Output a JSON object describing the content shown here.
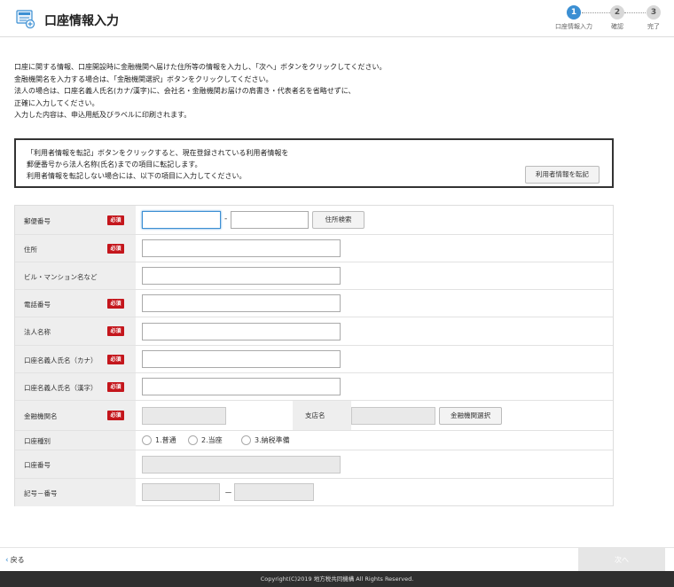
{
  "header": {
    "title": "口座情報入力",
    "steps": [
      {
        "num": "1",
        "label": "口座情報入力",
        "state": "active"
      },
      {
        "num": "2",
        "label": "確認",
        "state": "inactive"
      },
      {
        "num": "3",
        "label": "完了",
        "state": "inactive"
      }
    ]
  },
  "intro": {
    "lines": [
      "口座に関する情報、口座開設時に金融機関へ届けた住所等の情報を入力し、「次へ」ボタンをクリックしてください。",
      "金融機関名を入力する場合は、「金融機関選択」ボタンをクリックしてください。",
      "法人の場合は、口座名義人氏名(カナ/漢字)に、会社名・金融機関お届けの肩書き・代表者名を省略せずに、",
      "正確に入力してください。",
      "入力した内容は、申込用紙及びラベルに印刷されます。"
    ]
  },
  "transfer": {
    "lines": [
      "「利用者情報を転記」ボタンをクリックすると、現在登録されている利用者情報を",
      "郵便番号から法人名称(氏名)までの項目に転記します。",
      "利用者情報を転記しない場合には、以下の項目に入力してください。"
    ],
    "button": "利用者情報を転記"
  },
  "form": {
    "required_badge": "必須",
    "postal": {
      "label": "郵便番号",
      "value1": "",
      "value2": "",
      "separator": "-",
      "search_button": "住所検索"
    },
    "address": {
      "label": "住所",
      "value": ""
    },
    "building": {
      "label": "ビル・マンション名など",
      "value": ""
    },
    "phone": {
      "label": "電話番号",
      "value": ""
    },
    "corp_name": {
      "label": "法人名称",
      "value": ""
    },
    "holder_kana": {
      "label": "口座名義人氏名（カナ）",
      "value": ""
    },
    "holder_kanji": {
      "label": "口座名義人氏名（漢字）",
      "value": ""
    },
    "bank": {
      "label": "金融機関名",
      "value": "",
      "branch_label": "支店名",
      "branch_value": "",
      "select_button": "金融機関選択"
    },
    "account_type": {
      "label": "口座種別",
      "options": [
        "1.普通",
        "2.当座",
        "3.納税準備"
      ]
    },
    "account_number": {
      "label": "口座番号",
      "value": ""
    },
    "symbol_number": {
      "label": "記号－番号",
      "value1": "",
      "value2": "",
      "separator": "－"
    }
  },
  "nav": {
    "back": "戻る",
    "next": "次へ"
  },
  "footer": {
    "copyright": "Copyright(C)2019 地方税共同機構 All Rights Reserved."
  },
  "colors": {
    "accent": "#3b8fd3",
    "required": "#c4161c",
    "footer_bg": "#2f2f2f"
  }
}
